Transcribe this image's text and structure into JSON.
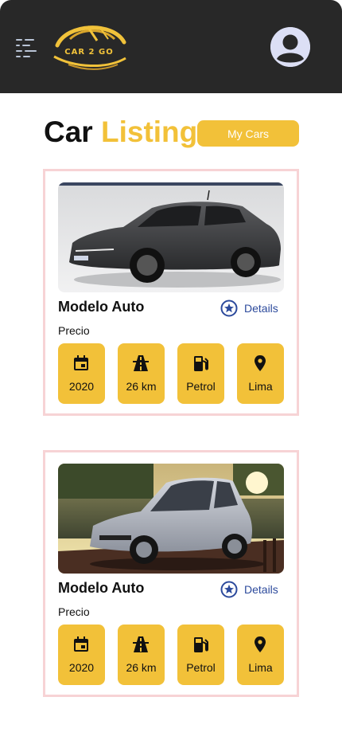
{
  "header": {
    "logo_text": "CAR 2 GO",
    "colors": {
      "bar": "#282828",
      "brand": "#f2c139"
    }
  },
  "page": {
    "title_part1": "Car",
    "title_part2": "Listing",
    "my_cars_label": "My Cars"
  },
  "listings": [
    {
      "name": "Modelo Auto",
      "details_label": "Details",
      "price_label": "Precio",
      "specs": [
        {
          "icon": "calendar-icon",
          "value": "2020"
        },
        {
          "icon": "road-icon",
          "value": "26 km"
        },
        {
          "icon": "fuel-icon",
          "value": "Petrol"
        },
        {
          "icon": "location-pin-icon",
          "value": "Lima"
        }
      ]
    },
    {
      "name": "Modelo Auto",
      "details_label": "Details",
      "price_label": "Precio",
      "specs": [
        {
          "icon": "calendar-icon",
          "value": "2020"
        },
        {
          "icon": "road-icon",
          "value": "26 km"
        },
        {
          "icon": "fuel-icon",
          "value": "Petrol"
        },
        {
          "icon": "location-pin-icon",
          "value": "Lima"
        }
      ]
    }
  ]
}
